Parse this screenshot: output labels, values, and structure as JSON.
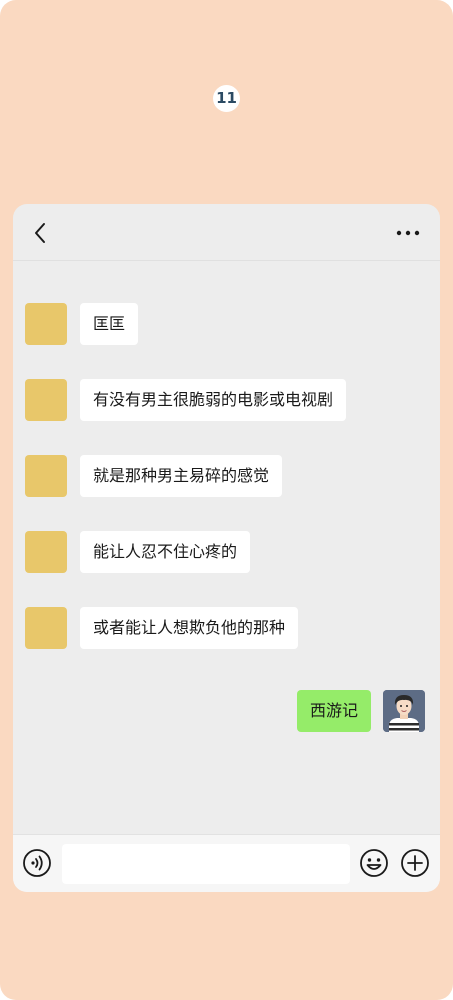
{
  "page_number": "11",
  "header": {
    "back_icon": "chevron-left-icon",
    "more_icon": "more-dots-icon"
  },
  "messages": [
    {
      "side": "left",
      "text": "匡匡"
    },
    {
      "side": "left",
      "text": "有没有男主很脆弱的电影或电视剧"
    },
    {
      "side": "left",
      "text": "就是那种男主易碎的感觉"
    },
    {
      "side": "left",
      "text": "能让人忍不住心疼的"
    },
    {
      "side": "left",
      "text": "或者能让人想欺负他的那种"
    },
    {
      "side": "right",
      "text": "西游记"
    }
  ],
  "input_bar": {
    "voice_icon": "voice-icon",
    "input_value": "",
    "emoji_icon": "emoji-icon",
    "plus_icon": "plus-icon"
  },
  "colors": {
    "background": "#fad9c1",
    "chat_background": "#ededed",
    "incoming_bubble": "#ffffff",
    "outgoing_bubble": "#95ec69",
    "avatar_placeholder": "#e8c76a"
  }
}
